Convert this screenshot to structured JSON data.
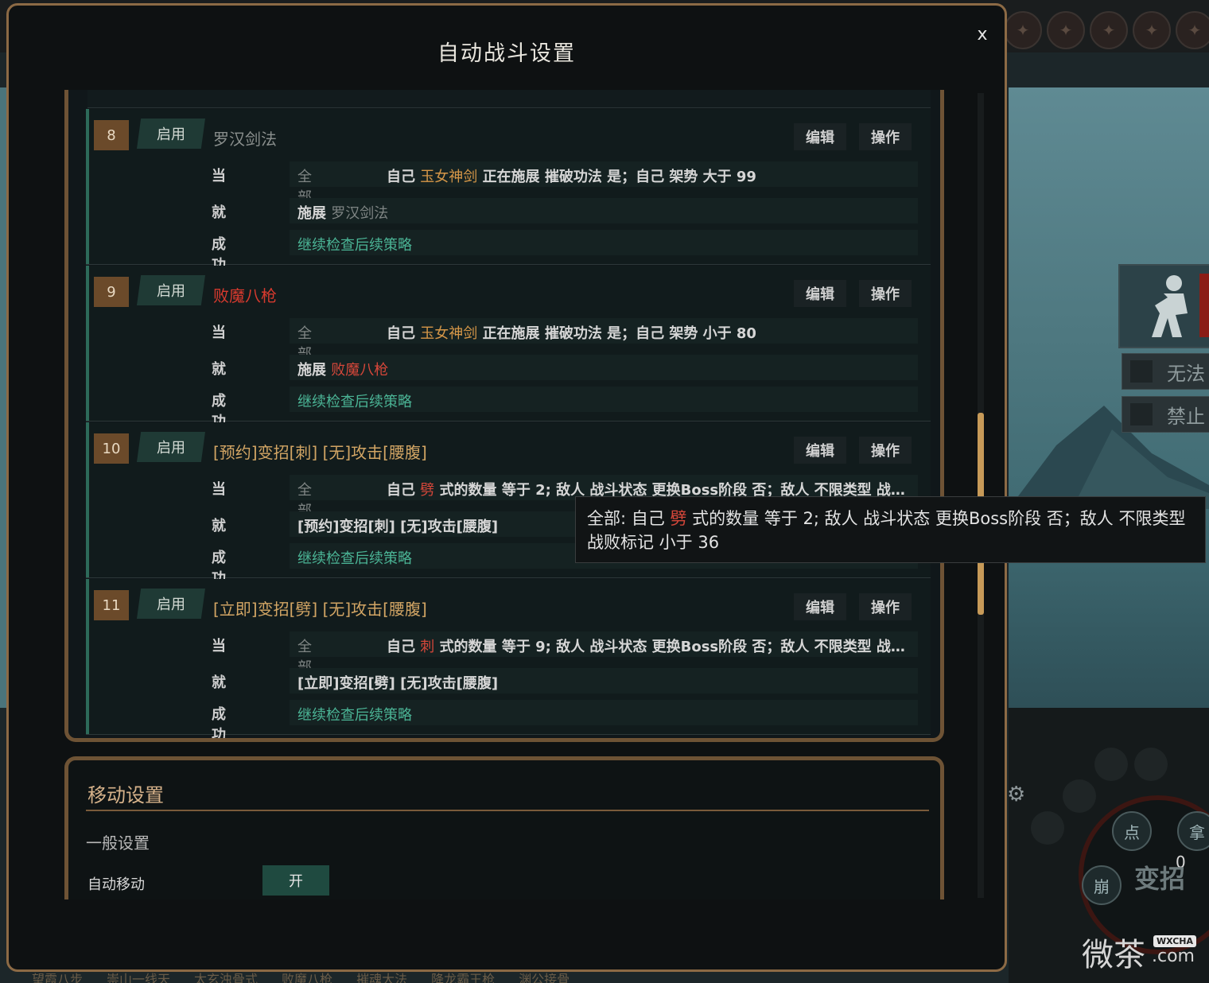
{
  "dialog": {
    "title": "自动战斗设置",
    "close_label": "x"
  },
  "strategies": [
    {
      "number": "8",
      "status": "启用",
      "name": "罗汉剑法",
      "edit_label": "编辑",
      "op_label": "操作",
      "when_label": "当",
      "scope": "全部",
      "cond_prefix": "自己",
      "cond_highlight": "玉女神剑",
      "cond_suffix": "正在施展 摧破功法 是；自己 架势 大于 99",
      "then_label": "就",
      "then_prefix": "施展",
      "then_highlight": "罗汉剑法",
      "after_label": "成功后",
      "after_text": "继续检查后续策略"
    },
    {
      "number": "9",
      "status": "启用",
      "name": "败魔八枪",
      "edit_label": "编辑",
      "op_label": "操作",
      "when_label": "当",
      "scope": "全部",
      "cond_prefix": "自己",
      "cond_highlight": "玉女神剑",
      "cond_suffix": "正在施展 摧破功法 是；自己 架势 小于 80",
      "then_label": "就",
      "then_prefix": "施展",
      "then_highlight": "败魔八枪",
      "after_label": "成功后",
      "after_text": "继续检查后续策略"
    },
    {
      "number": "10",
      "status": "启用",
      "name": "[预约]变招[刺] [无]攻击[腰腹]",
      "edit_label": "编辑",
      "op_label": "操作",
      "when_label": "当",
      "scope": "全部",
      "cond_prefix": "自己",
      "cond_highlight": "劈",
      "cond_suffix": "式的数量 等于 2; 敌人 战斗状态 更换Boss阶段 否；敌人 不限类型 战…",
      "then_label": "就",
      "then_text": "[预约]变招[刺] [无]攻击[腰腹]",
      "after_label": "成功后",
      "after_text": "继续检查后续策略"
    },
    {
      "number": "11",
      "status": "启用",
      "name": "[立即]变招[劈] [无]攻击[腰腹]",
      "edit_label": "编辑",
      "op_label": "操作",
      "when_label": "当",
      "scope": "全部",
      "cond_prefix": "自己",
      "cond_highlight": "刺",
      "cond_suffix": "式的数量 等于 9; 敌人 战斗状态 更换Boss阶段 否；敌人 不限类型 战…",
      "then_label": "就",
      "then_text": "[立即]变招[劈] [无]攻击[腰腹]",
      "after_label": "成功后",
      "after_text": "继续检查后续策略"
    }
  ],
  "tooltip": {
    "prefix": "全部: 自己",
    "highlight": "劈",
    "line1_suffix": "式的数量 等于 2; 敌人 战斗状态 更换Boss阶段 否；敌人 不限类型",
    "line2": "战败标记 小于 36"
  },
  "movement": {
    "title": "移动设置",
    "subtitle": "一般设置",
    "auto_move_label": "自动移动",
    "auto_move_value": "开"
  },
  "background": {
    "side_options": [
      "无法",
      "禁止"
    ],
    "wheel_buttons": [
      "点",
      "拿",
      "崩"
    ],
    "wheel_count": "0",
    "wheel_center": "变招",
    "watermark": "微茶",
    "watermark_badge": "WXCHA",
    "watermark_domain": ".com",
    "bottom_skills": [
      "望霞八步",
      "崇山一线天",
      "太玄浊骨式",
      "败魔八枪",
      "摧魂大法",
      "降龙霸王枪",
      "渊公接骨"
    ]
  },
  "colors": {
    "accent_gold": "#c79a58",
    "frame_brown": "#8c6a45",
    "enabled_green": "#1f3a35",
    "highlight_orange": "#d69748",
    "highlight_red": "#d83a2e",
    "followup_green": "#4bb596"
  }
}
